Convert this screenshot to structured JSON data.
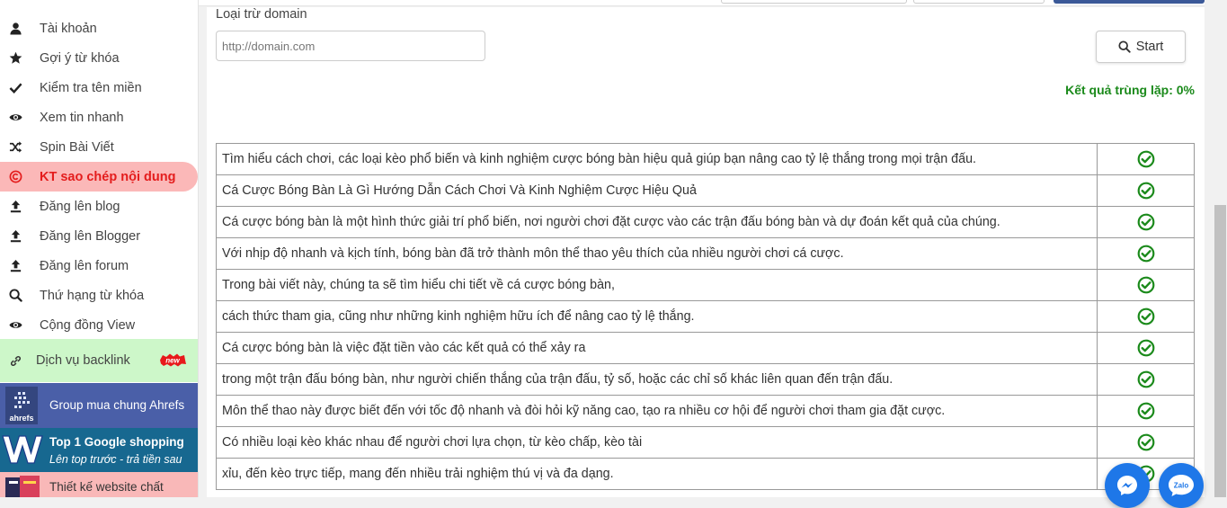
{
  "sidebar": {
    "items": [
      {
        "label": "Tài khoản",
        "icon": "user-icon"
      },
      {
        "label": "Gợi ý từ khóa",
        "icon": "star-icon"
      },
      {
        "label": "Kiểm tra tên miền",
        "icon": "check-icon"
      },
      {
        "label": "Xem tin nhanh",
        "icon": "eye-icon"
      },
      {
        "label": "Spin Bài Viết",
        "icon": "shuffle-icon"
      },
      {
        "label": "KT sao chép nội dung",
        "icon": "copyright-icon",
        "active": true
      },
      {
        "label": "Đăng lên blog",
        "icon": "upload-icon"
      },
      {
        "label": "Đăng lên Blogger",
        "icon": "upload-icon"
      },
      {
        "label": "Đăng lên forum",
        "icon": "upload-icon"
      },
      {
        "label": "Thứ hạng từ khóa",
        "icon": "search-icon"
      },
      {
        "label": "Cộng đồng View",
        "icon": "eye-icon"
      }
    ],
    "backlink": {
      "label": "Dịch vụ backlink",
      "badge": "new"
    },
    "promos": {
      "ahrefs": {
        "logo_text": "ahrefs",
        "label": "Group mua chung Ahrefs"
      },
      "google": {
        "title": "Top 1 Google shopping",
        "subtitle": "Lên top trước - trả tiền sau"
      },
      "web": {
        "label": "Thiết kế website chất"
      }
    }
  },
  "form": {
    "domain_label": "Loại trừ domain",
    "domain_placeholder": "http://domain.com",
    "start_label": "Start"
  },
  "result": {
    "text": "Kết quả trùng lặp: 0%"
  },
  "rows": [
    "Tìm hiểu cách chơi, các loại kèo phổ biến và kinh nghiệm cược bóng bàn hiệu quả giúp bạn nâng cao tỷ lệ thắng trong mọi trận đấu.",
    "Cá Cược Bóng Bàn Là Gì Hướng Dẫn Cách Chơi Và Kinh Nghiệm Cược Hiệu Quả",
    "Cá cược bóng bàn là một hình thức giải trí phổ biến, nơi người chơi đặt cược vào các trận đấu bóng bàn và dự đoán kết quả của chúng.",
    "Với nhịp độ nhanh và kịch tính, bóng bàn đã trở thành môn thể thao yêu thích của nhiều người chơi cá cược.",
    "Trong bài viết này, chúng ta sẽ tìm hiểu chi tiết về cá cược bóng bàn,",
    "cách thức tham gia, cũng như những kinh nghiệm hữu ích để nâng cao tỷ lệ thắng.",
    "Cá cược bóng bàn là việc đặt tiền vào các kết quả có thể xảy ra",
    "trong một trận đấu bóng bàn, như người chiến thắng của trận đấu, tỷ số, hoặc các chỉ số khác liên quan đến trận đấu.",
    "Môn thể thao này được biết đến với tốc độ nhanh và đòi hỏi kỹ năng cao, tạo ra nhiều cơ hội để người chơi tham gia đặt cược.",
    "Có nhiều loại kèo khác nhau để người chơi lựa chọn, từ kèo chấp, kèo tài",
    "xỉu, đến kèo trực tiếp, mang đến nhiều trải nghiệm thú vị và đa dạng."
  ],
  "chat": {
    "zalo_label": "Zalo"
  },
  "colors": {
    "accent_green": "#1b8a1b",
    "active_bg": "#fbb8b8",
    "active_text": "#e41d1d"
  }
}
